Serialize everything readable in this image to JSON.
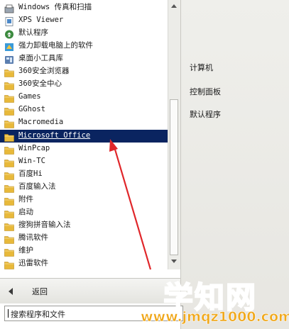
{
  "program_list": [
    {
      "label": "Windows 传真和扫描",
      "icon": "fax-scan-icon"
    },
    {
      "label": "XPS Viewer",
      "icon": "xps-viewer-icon"
    },
    {
      "label": "默认程序",
      "icon": "default-programs-icon"
    },
    {
      "label": "强力卸载电脑上的软件",
      "icon": "uninstaller-icon"
    },
    {
      "label": "桌面小工具库",
      "icon": "gadgets-icon"
    },
    {
      "label": "360安全浏览器",
      "icon": "folder-icon"
    },
    {
      "label": "360安全中心",
      "icon": "folder-icon"
    },
    {
      "label": "Games",
      "icon": "folder-icon"
    },
    {
      "label": "GGhost",
      "icon": "folder-icon"
    },
    {
      "label": "Macromedia",
      "icon": "folder-icon"
    },
    {
      "label": "Microsoft Office",
      "icon": "folder-icon",
      "selected": true
    },
    {
      "label": "WinPcap",
      "icon": "folder-icon"
    },
    {
      "label": "Win-TC",
      "icon": "folder-icon"
    },
    {
      "label": "百度Hi",
      "icon": "folder-icon"
    },
    {
      "label": "百度输入法",
      "icon": "folder-icon"
    },
    {
      "label": "附件",
      "icon": "folder-icon"
    },
    {
      "label": "启动",
      "icon": "folder-icon"
    },
    {
      "label": "搜狗拼音输入法",
      "icon": "folder-icon"
    },
    {
      "label": "腾讯软件",
      "icon": "folder-icon"
    },
    {
      "label": "维护",
      "icon": "folder-icon"
    },
    {
      "label": "迅雷软件",
      "icon": "folder-icon"
    }
  ],
  "right_panel": {
    "computer": "计算机",
    "control_panel": "控制面板",
    "default_programs": "默认程序"
  },
  "back": {
    "label": "返回"
  },
  "search": {
    "placeholder": "搜索程序和文件"
  },
  "watermark": {
    "big": "学知网",
    "small": "www.jmqz1000.com"
  },
  "colors": {
    "selection": "#0a2460",
    "arrow": "#e0262a",
    "folder": "#e8b93a"
  }
}
